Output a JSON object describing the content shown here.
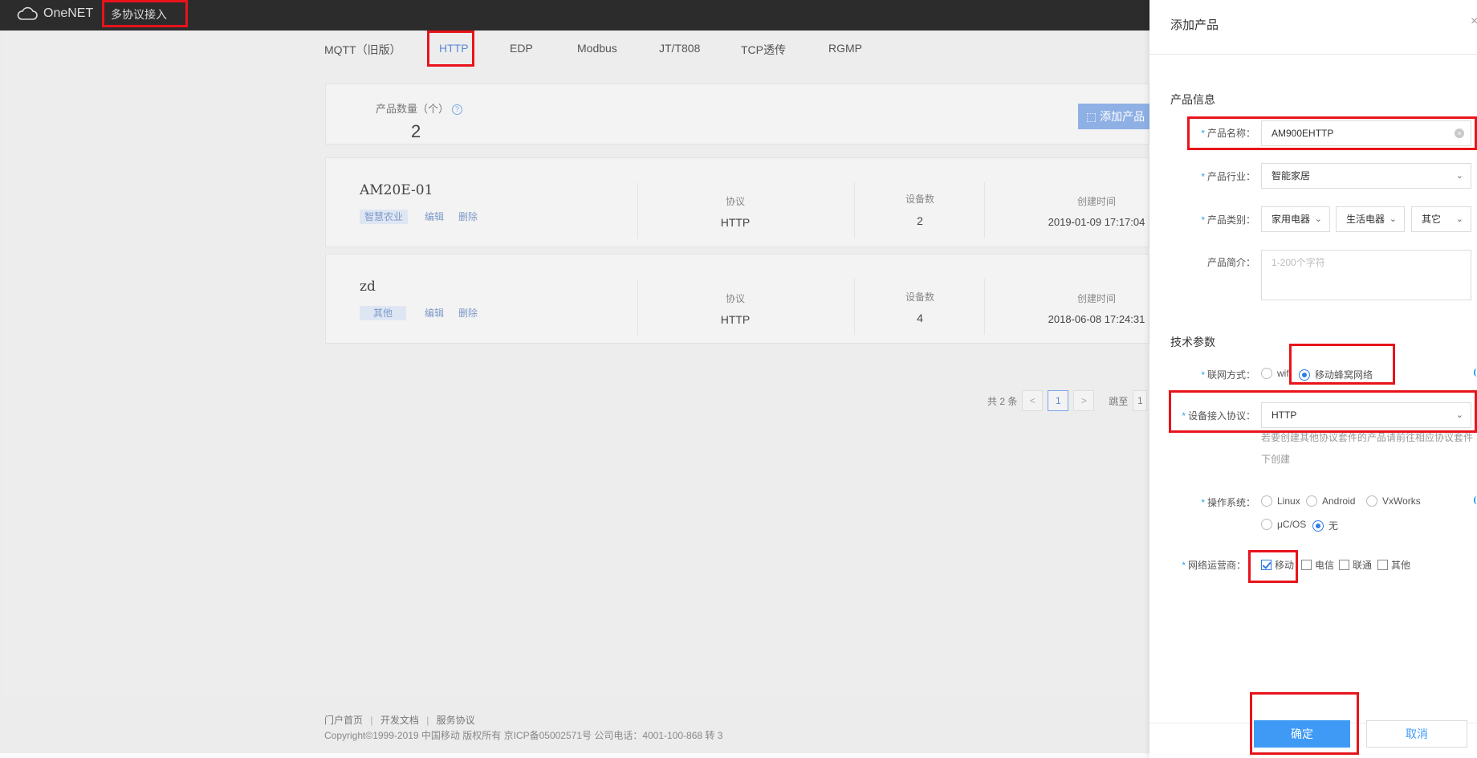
{
  "topbar": {
    "brand": "OneNET",
    "nav": "多协议接入"
  },
  "tabs": [
    "MQTT（旧版）",
    "HTTP",
    "EDP",
    "Modbus",
    "JT/T808",
    "TCP透传",
    "RGMP"
  ],
  "summary": {
    "label": "产品数量（个）",
    "count": "2",
    "add_button": "添加产品"
  },
  "products": [
    {
      "name": "AM20E-01",
      "tag": "智慧农业",
      "edit": "编辑",
      "delete": "删除",
      "protocol_label": "协议",
      "protocol": "HTTP",
      "devices_label": "设备数",
      "devices": "2",
      "created_label": "创建时间",
      "created": "2019-01-09 17:17:04"
    },
    {
      "name": "zd",
      "tag": "其他",
      "edit": "编辑",
      "delete": "删除",
      "protocol_label": "协议",
      "protocol": "HTTP",
      "devices_label": "设备数",
      "devices": "4",
      "created_label": "创建时间",
      "created": "2018-06-08 17:24:31"
    }
  ],
  "pager": {
    "total": "共 2 条",
    "prev": "<",
    "page": "1",
    "next": ">",
    "jump": "跳至",
    "jump_value": "1"
  },
  "footer": {
    "links": [
      "门户首页",
      "开发文档",
      "服务协议"
    ],
    "copyright": "Copyright©1999-2019 中国移动 版权所有 京ICP备05002571号 公司电话：4001-100-868 转 3"
  },
  "drawer": {
    "title": "添加产品",
    "close": "×",
    "section_info": "产品信息",
    "name_label": "产品名称：",
    "name_value": "AM900EHTTP",
    "industry_label": "产品行业：",
    "industry_value": "智能家居",
    "category_label": "产品类别：",
    "category_values": [
      "家用电器",
      "生活电器",
      "其它"
    ],
    "intro_label": "产品简介：",
    "intro_placeholder": "1-200个字符",
    "section_tech": "技术参数",
    "network_label": "联网方式：",
    "network_options": [
      "wifi",
      "移动蜂窝网络"
    ],
    "network_selected": "移动蜂窝网络",
    "protocol_label": "设备接入协议：",
    "protocol_value": "HTTP",
    "protocol_hint": "若要创建其他协议套件的产品请前往相应协议套件下创建",
    "os_label": "操作系统：",
    "os_options": [
      "Linux",
      "Android",
      "VxWorks",
      "μC/OS",
      "无"
    ],
    "os_selected": "无",
    "carrier_label": "网络运营商：",
    "carrier_options": [
      "移动",
      "电信",
      "联通",
      "其他"
    ],
    "carrier_checked": [
      "移动"
    ],
    "ok_button": "确定",
    "cancel_button": "取消"
  },
  "colors": {
    "accent": "#3f9af5",
    "highlight": "#e8141b",
    "topbar": "#2c2c2c"
  }
}
